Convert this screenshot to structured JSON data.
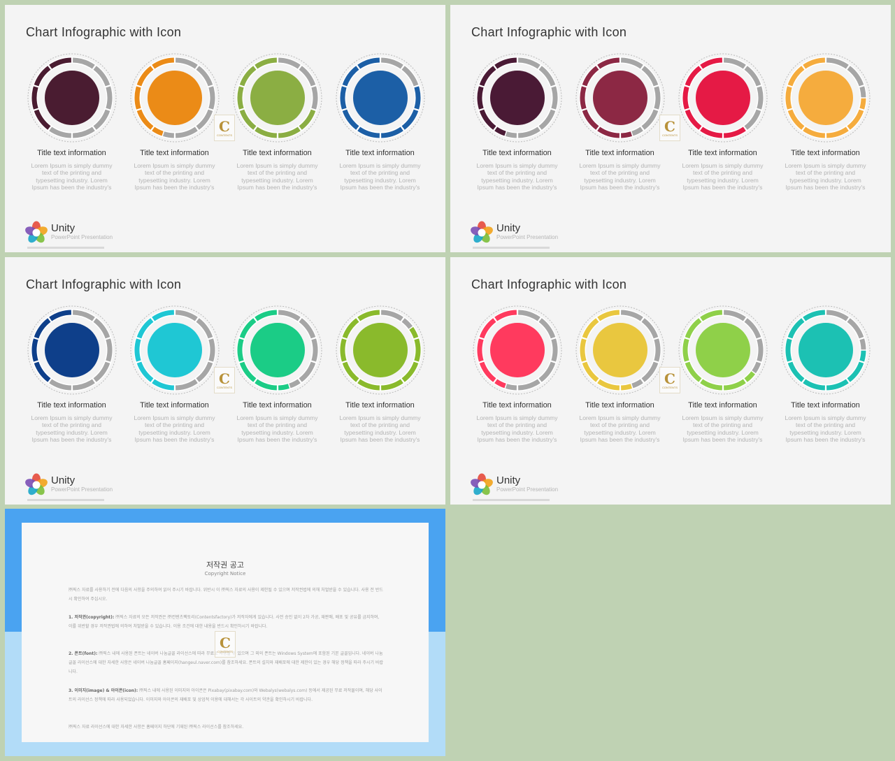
{
  "slide_title": "Chart Infographic with Icon",
  "item_title": "Title  text information",
  "item_body": "Lorem Ipsum is simply dummy text of the printing and typesetting industry. Lorem Ipsum has been the industry's",
  "brand": {
    "name": "Unity",
    "subtitle": "PowerPoint Presentation"
  },
  "watermark": {
    "letter": "C",
    "text": "CONTENTS"
  },
  "slides": [
    {
      "id": "slide-1",
      "colors": [
        "#4a1c31",
        "#eb8b17",
        "#8bae43",
        "#1c5fa6"
      ],
      "progress": [
        0.4,
        0.45,
        0.7,
        0.8
      ]
    },
    {
      "id": "slide-2",
      "colors": [
        "#4a1a35",
        "#8c2844",
        "#e51a45",
        "#f5ac3e"
      ],
      "progress": [
        0.45,
        0.55,
        0.6,
        0.75
      ]
    },
    {
      "id": "slide-3",
      "colors": [
        "#0e3f8a",
        "#1fc7d4",
        "#1bcc86",
        "#8aba2c"
      ],
      "progress": [
        0.4,
        0.5,
        0.55,
        0.85
      ]
    },
    {
      "id": "slide-4",
      "colors": [
        "#ff3a5e",
        "#e9c73f",
        "#8fd049",
        "#1cc1b3"
      ],
      "progress": [
        0.45,
        0.55,
        0.65,
        0.75
      ]
    }
  ],
  "notice": {
    "title": "저작권 공고",
    "subtitle": "Copyright Notice",
    "intro": "㈜픽스 자료를 사용하기 전에 다음의 사항을 주의하여 읽어 주시기 바랍니다. 위반시 이 ㈜픽스 자료의 사용이 제한될 수 있으며 저작권법에 의해 처벌받을 수 있습니다. 사용 전 반드시 확인하여 주십시오.",
    "p1_label": "1. 저작권(copyright):",
    "p1": " ㈜픽스 자료의 모든 저작권은 ㈜컨텐츠팩토리(Contentsfactory)가 저작자에게 있습니다. 사전 승인 없이 2차 가공, 재판매, 배포 및 공유를 금지하며, 이를 위반할 경우 저작권법에 의하여 처벌받을 수 있습니다. 이용 조건에 대한 내용을 반드시 확인하시기 바랍니다.",
    "p2_label": "2. 폰트(font):",
    "p2": " ㈜픽스 내에 사용된 폰트는 네이버 나눔글꼴 라이선스에 따라 무료로 사용할 수 있으며 그 외의 폰트는 Windows System에 포함된 기본 글꼴입니다. 네이버 나눔글꼴 라이선스에 대한 자세한 사항은 네이버 나눔글꼴 홈페이지(hangeul.naver.com)를 참조하세요. 폰트의 설치와 재배포에 대한 제한이 있는 경우 해당 정책을 따라 주시기 바랍니다.",
    "p3_label": "3. 이미지(image) & 아이콘(icon):",
    "p3": " ㈜픽스 내에 사용된 이미지와 아이콘은 Pixabay(pixabay.com)와 Webalys(webalys.com) 등에서 제공된 무료 저작물이며, 해당 사이트의 라이선스 정책에 따라 사용되었습니다. 이미지와 아이콘의 재배포 및 상업적 이용에 대해서는 각 사이트의 약관을 확인하시기 바랍니다.",
    "outro": "㈜픽스 자료 라이선스에 대한 자세한 사항은 홈페이지 하단에 기재된 ㈜픽스 라이선스를 참조하세요."
  }
}
